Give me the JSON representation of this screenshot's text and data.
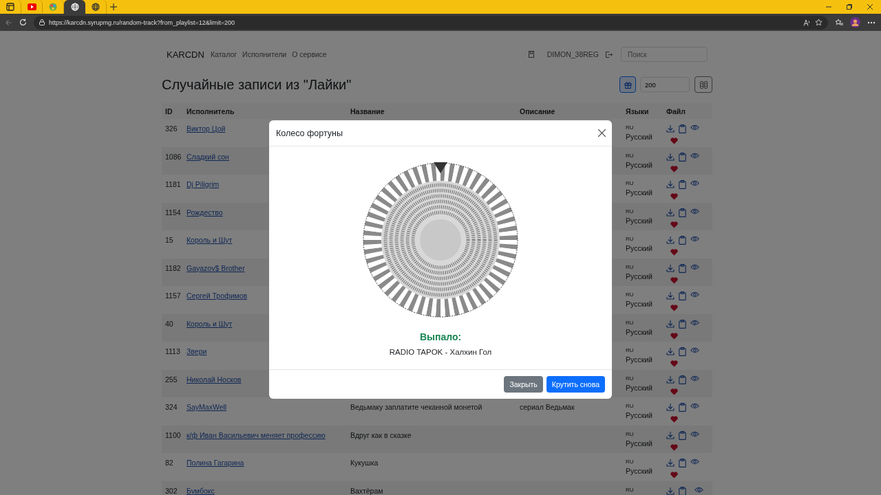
{
  "browser": {
    "tabs": [
      {
        "kind": "panel",
        "selected": false
      },
      {
        "kind": "video",
        "selected": false
      },
      {
        "kind": "palette",
        "selected": false
      },
      {
        "kind": "globe",
        "selected": true
      },
      {
        "kind": "globe",
        "selected": false
      }
    ],
    "url": "https://karcdn.syrupmg.ru/random-track?from_playlist=12&limit=200"
  },
  "nav": {
    "brand": "KARCDN",
    "links": [
      "Каталог",
      "Исполнители",
      "О сервисе"
    ],
    "user": "DIMON_38REG",
    "search": {
      "placeholder": "Поиск"
    }
  },
  "page": {
    "title": "Случайные записи из \"Лайки\"",
    "limit": "200"
  },
  "table": {
    "columns": [
      "ID",
      "Исполнитель",
      "Название",
      "Описание",
      "Языки",
      "Файл"
    ],
    "rows": [
      {
        "id": "326",
        "artist": "Виктор Цой",
        "lang_code": "RU",
        "lang": "Русский"
      },
      {
        "id": "1086",
        "artist": "Сладкий сон",
        "lang_code": "RU",
        "lang": "Русский"
      },
      {
        "id": "1181",
        "artist": "Dj Piligrim",
        "lang_code": "RU",
        "lang": "Русский"
      },
      {
        "id": "1154",
        "artist": "Рождество",
        "lang_code": "RU",
        "lang": "Русский"
      },
      {
        "id": "15",
        "artist": "Король и Шут",
        "lang_code": "RU",
        "lang": "Русский"
      },
      {
        "id": "1182",
        "artist": "Gayazov$ Brother",
        "lang_code": "RU",
        "lang": "Русский"
      },
      {
        "id": "1157",
        "artist": "Сергей Трофимов",
        "lang_code": "RU",
        "lang": "Русский"
      },
      {
        "id": "40",
        "artist": "Король и Шут",
        "lang_code": "RU",
        "lang": "Русский"
      },
      {
        "id": "1113",
        "artist": "Звери",
        "lang_code": "RU",
        "lang": "Русский"
      },
      {
        "id": "255",
        "artist": "Николай Носков",
        "lang_code": "RU",
        "lang": "Русский"
      },
      {
        "id": "324",
        "artist": "SayMaxWell",
        "title": "Ведьмаку заплатите чеканной монетой",
        "description": "сериал Ведьмак",
        "lang_code": "RU",
        "lang": "Русский"
      },
      {
        "id": "1100",
        "artist": "к/ф Иван Васильевич меняет профессию",
        "title": "Вдруг как в сказке",
        "lang_code": "RU",
        "lang": "Русский"
      },
      {
        "id": "82",
        "artist": "Полина Гагарина",
        "title": "Кукушка",
        "lang_code": "RU",
        "lang": "Русский"
      },
      {
        "id": "302",
        "artist": "Бумбокс",
        "title": "Вахтёрам",
        "lang_code": "RU"
      }
    ]
  },
  "modal": {
    "title": "Колесо фортуны",
    "result_label": "Выпало:",
    "result": "RADIO TAPOK - Халхин Гол",
    "buttons": [
      {
        "label": "Закрыть",
        "kind": "secondary"
      },
      {
        "label": "Крутить снова",
        "kind": "primary"
      }
    ]
  }
}
